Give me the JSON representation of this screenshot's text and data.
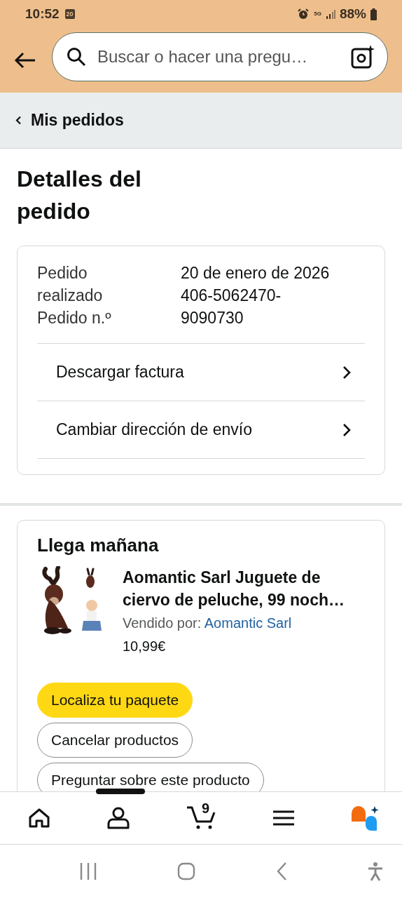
{
  "status_bar": {
    "time": "10:52",
    "calendar_badge": "20",
    "network": "5G",
    "battery": "88%"
  },
  "header": {
    "search": {
      "placeholder": "Buscar o hacer una pregu…"
    }
  },
  "breadcrumb": {
    "label": "Mis pedidos"
  },
  "page_title": "Detalles del pedido",
  "order_summary": {
    "labels": [
      "Pedido realizado",
      "Pedido n.º"
    ],
    "values": [
      "20 de enero de 2026",
      "406-5062470-9090730"
    ],
    "links": [
      {
        "label": "Descargar factura"
      },
      {
        "label": "Cambiar dirección de envío"
      }
    ]
  },
  "shipment": {
    "heading": "Llega mañana",
    "items": [
      {
        "title": "Aomantic Sarl Juguete de ciervo de peluche, 99 noch…",
        "seller_label": "Vendido por:",
        "seller": "Aomantic Sarl",
        "price": "10,99€"
      }
    ],
    "actions": [
      {
        "label": "Localiza tu paquete",
        "kind": "primary"
      },
      {
        "label": "Cancelar productos",
        "kind": "secondary"
      },
      {
        "label": "Preguntar sobre este producto",
        "kind": "secondary"
      }
    ]
  },
  "bottom_nav": {
    "items": [
      {
        "kind": "home"
      },
      {
        "kind": "account"
      },
      {
        "kind": "cart",
        "badge": "9"
      },
      {
        "kind": "menu"
      },
      {
        "kind": "assistant"
      }
    ]
  }
}
